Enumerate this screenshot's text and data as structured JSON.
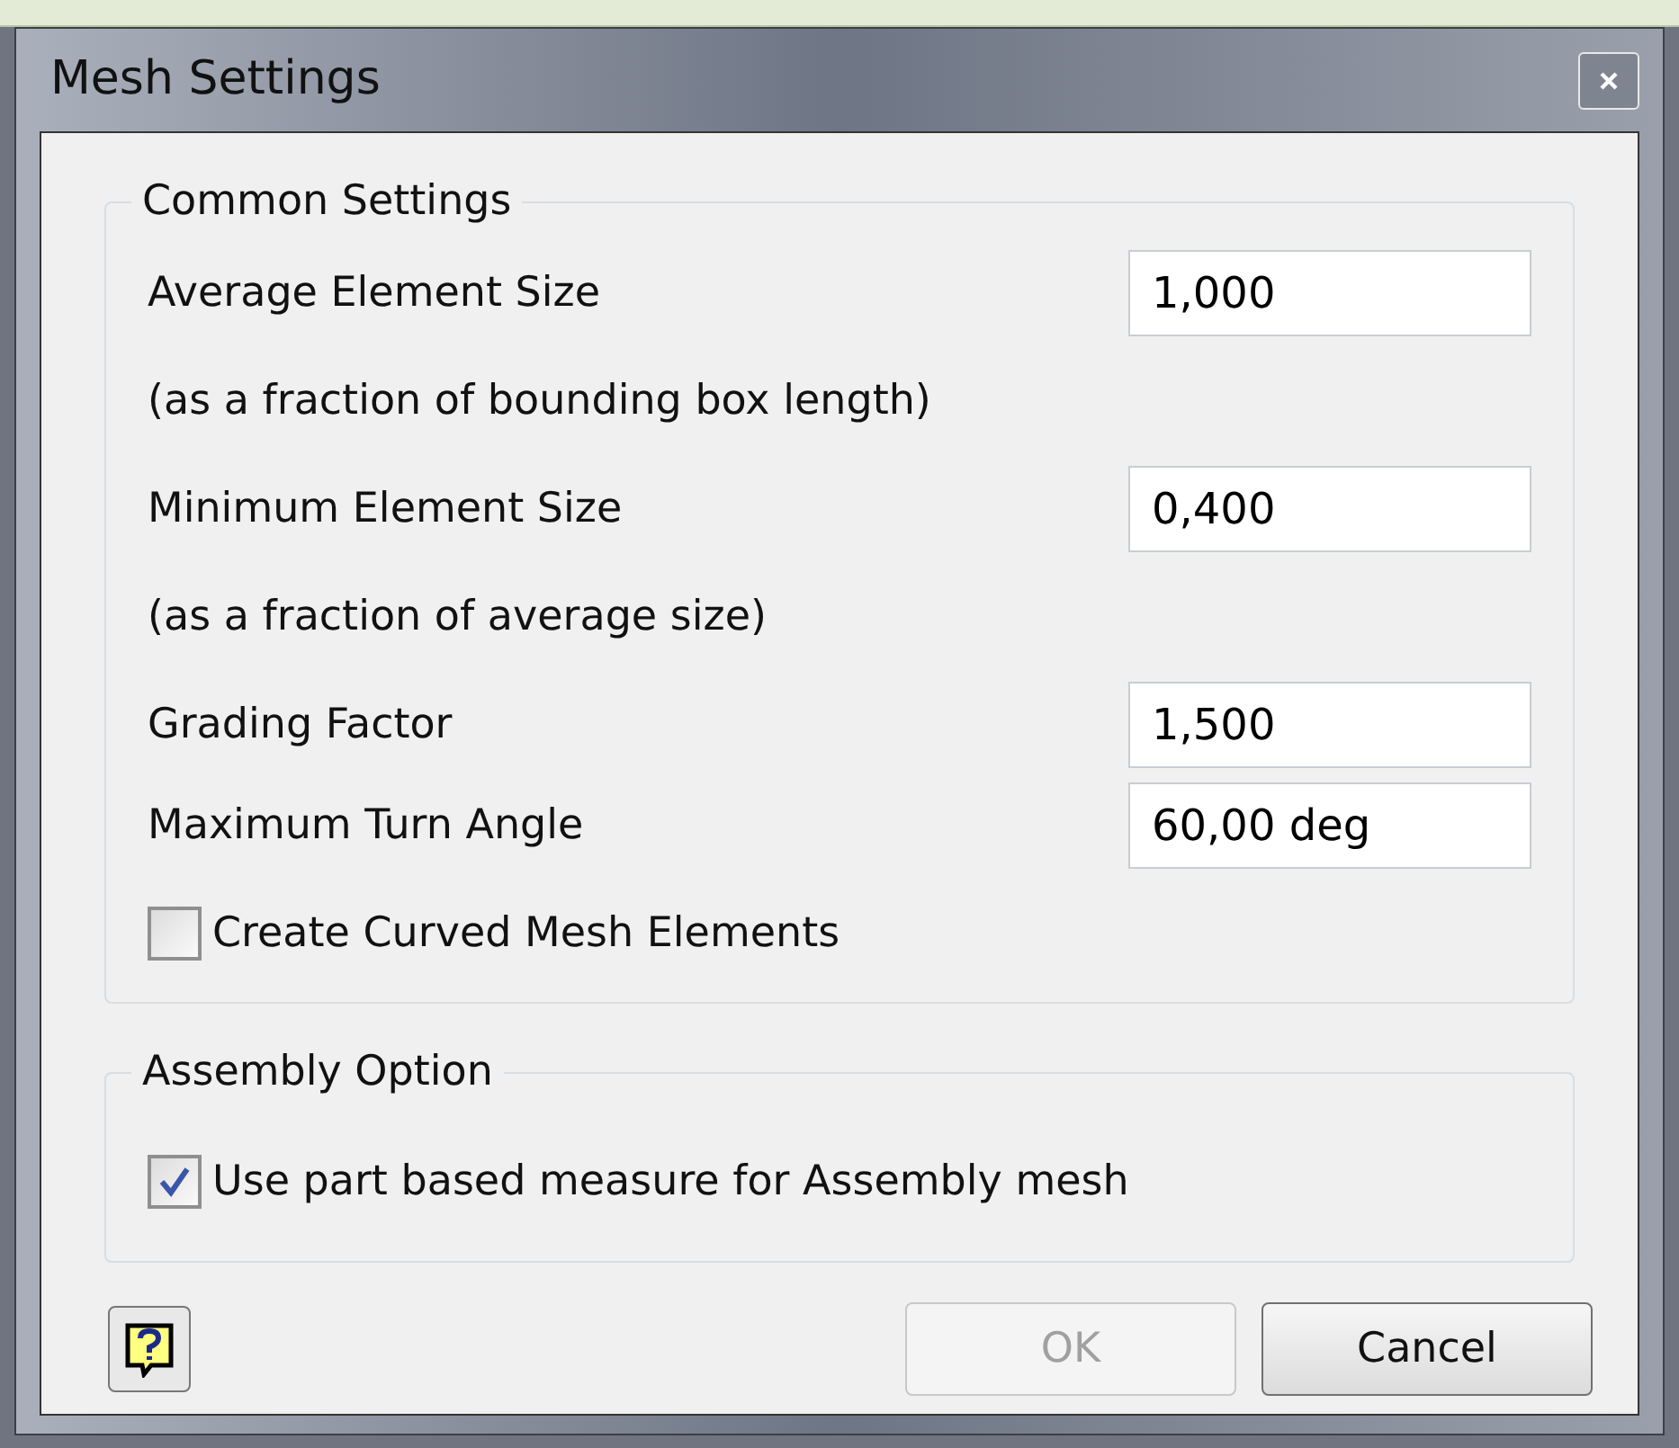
{
  "window": {
    "title": "Mesh Settings"
  },
  "common_settings": {
    "title": "Common Settings",
    "rows": [
      {
        "kind": "field",
        "label": "Average Element Size",
        "value": "1,000"
      },
      {
        "kind": "note",
        "label": "(as a fraction of bounding box length)"
      },
      {
        "kind": "field",
        "label": "Minimum Element Size",
        "value": "0,400"
      },
      {
        "kind": "note",
        "label": "(as a fraction of average size)"
      },
      {
        "kind": "field",
        "label": "Grading Factor",
        "value": "1,500"
      },
      {
        "kind": "field",
        "label": "Maximum Turn Angle",
        "value": "60,00 deg"
      },
      {
        "kind": "checkbox",
        "label": "Create Curved Mesh Elements",
        "checked": false
      }
    ]
  },
  "assembly_option": {
    "title": "Assembly Option",
    "rows": [
      {
        "kind": "checkbox",
        "label": "Use part based measure for Assembly mesh",
        "checked": true
      }
    ]
  },
  "buttons": [
    {
      "label": "OK",
      "disabled": true
    },
    {
      "label": "Cancel",
      "disabled": false
    }
  ]
}
